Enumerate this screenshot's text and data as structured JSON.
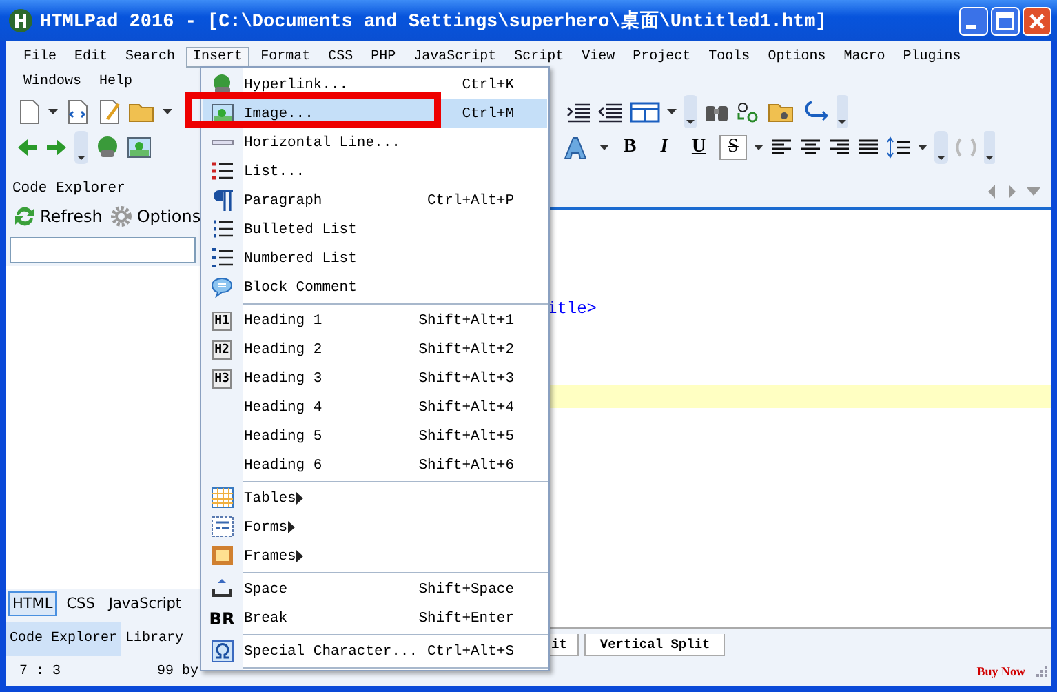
{
  "window": {
    "title": "HTMLPad 2016 - [C:\\Documents and Settings\\superhero\\桌面\\Untitled1.htm]"
  },
  "menubar": [
    [
      {
        "label": "File",
        "selected": false
      },
      {
        "label": "Edit",
        "selected": false
      },
      {
        "label": "Search",
        "selected": false
      },
      {
        "label": "Insert",
        "selected": true
      },
      {
        "label": "Format",
        "selected": false
      },
      {
        "label": "CSS",
        "selected": false
      },
      {
        "label": "PHP",
        "selected": false
      },
      {
        "label": "JavaScript",
        "selected": false
      },
      {
        "label": "Script",
        "selected": false
      },
      {
        "label": "View",
        "selected": false
      },
      {
        "label": "Project",
        "selected": false
      },
      {
        "label": "Tools",
        "selected": false
      },
      {
        "label": "Options",
        "selected": false
      },
      {
        "label": "Macro",
        "selected": false
      },
      {
        "label": "Plugins",
        "selected": false
      }
    ],
    [
      {
        "label": "Windows",
        "selected": false
      },
      {
        "label": "Help",
        "selected": false
      }
    ]
  ],
  "format_buttons": [
    "B",
    "I",
    "U",
    "S"
  ],
  "code_explorer": {
    "title": "Code Explorer",
    "buttons": [
      "Refresh",
      "Options"
    ],
    "language_tabs": [
      {
        "label": "HTML",
        "selected": true
      },
      {
        "label": "CSS",
        "selected": false
      },
      {
        "label": "JavaScript",
        "selected": false
      }
    ],
    "panel_tabs": [
      {
        "label": "Code Explorer",
        "selected": true
      },
      {
        "label": "Library",
        "selected": false
      }
    ]
  },
  "editor": {
    "code_line": "itle>",
    "view_tabs": [
      "it",
      "Vertical Split"
    ]
  },
  "status_bar": {
    "position": "7 : 3",
    "size": "99 by",
    "buy": "Buy Now"
  },
  "insert_menu": [
    {
      "kind": "item",
      "label": "Hyperlink...",
      "shortcut": "Ctrl+K",
      "submenu": false,
      "selected": false,
      "annotated": false
    },
    {
      "kind": "item",
      "label": "Image...",
      "shortcut": "Ctrl+M",
      "submenu": false,
      "selected": true,
      "annotated": true
    },
    {
      "kind": "item",
      "label": "Horizontal Line...",
      "submenu": false,
      "selected": false,
      "annotated": false
    },
    {
      "kind": "item",
      "label": "List...",
      "submenu": false,
      "selected": false,
      "annotated": false
    },
    {
      "kind": "item",
      "label": "Paragraph",
      "shortcut": "Ctrl+Alt+P",
      "submenu": false,
      "selected": false,
      "annotated": false
    },
    {
      "kind": "item",
      "label": "Bulleted List",
      "submenu": false,
      "selected": false,
      "annotated": false
    },
    {
      "kind": "item",
      "label": "Numbered List",
      "submenu": false,
      "selected": false,
      "annotated": false
    },
    {
      "kind": "item",
      "label": "Block Comment",
      "submenu": false,
      "selected": false,
      "annotated": false
    },
    {
      "kind": "separator"
    },
    {
      "kind": "item",
      "label": "Heading 1",
      "icon_text": "H1",
      "shortcut": "Shift+Alt+1",
      "submenu": false,
      "selected": false,
      "annotated": false
    },
    {
      "kind": "item",
      "label": "Heading 2",
      "icon_text": "H2",
      "shortcut": "Shift+Alt+2",
      "submenu": false,
      "selected": false,
      "annotated": false
    },
    {
      "kind": "item",
      "label": "Heading 3",
      "icon_text": "H3",
      "shortcut": "Shift+Alt+3",
      "submenu": false,
      "selected": false,
      "annotated": false
    },
    {
      "kind": "item",
      "label": "Heading 4",
      "shortcut": "Shift+Alt+4",
      "submenu": false,
      "selected": false,
      "annotated": false
    },
    {
      "kind": "item",
      "label": "Heading 5",
      "shortcut": "Shift+Alt+5",
      "submenu": false,
      "selected": false,
      "annotated": false
    },
    {
      "kind": "item",
      "label": "Heading 6",
      "shortcut": "Shift+Alt+6",
      "submenu": false,
      "selected": false,
      "annotated": false
    },
    {
      "kind": "separator"
    },
    {
      "kind": "item",
      "label": "Tables",
      "submenu": true,
      "selected": false,
      "annotated": false
    },
    {
      "kind": "item",
      "label": "Forms",
      "submenu": true,
      "selected": false,
      "annotated": false
    },
    {
      "kind": "item",
      "label": "Frames",
      "submenu": true,
      "selected": false,
      "annotated": false
    },
    {
      "kind": "separator"
    },
    {
      "kind": "item",
      "label": "Space",
      "shortcut": "Shift+Space",
      "submenu": false,
      "selected": false,
      "annotated": false
    },
    {
      "kind": "item",
      "label": "Break",
      "icon_text": "BR",
      "shortcut": "Shift+Enter",
      "submenu": false,
      "selected": false,
      "annotated": false
    },
    {
      "kind": "separator"
    },
    {
      "kind": "item",
      "label": "Special Character...",
      "shortcut": "Ctrl+Alt+S",
      "submenu": false,
      "selected": false,
      "annotated": false
    },
    {
      "kind": "separator"
    }
  ]
}
